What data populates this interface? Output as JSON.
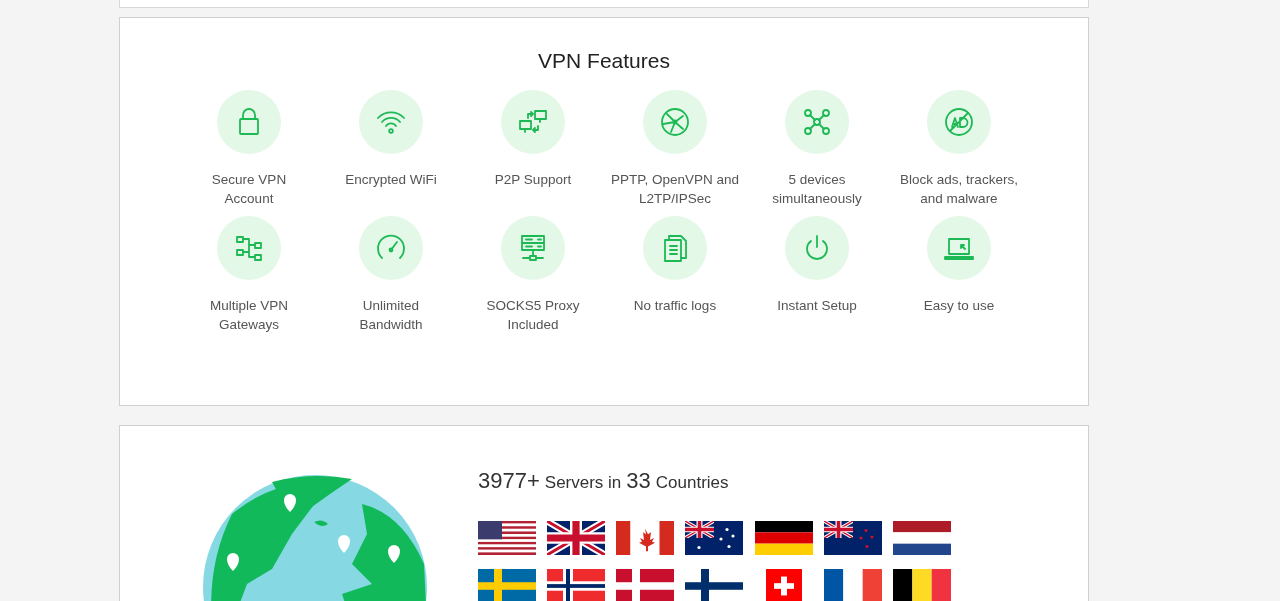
{
  "features": {
    "title": "VPN Features",
    "items": [
      {
        "kind": "lock",
        "label": "Secure VPN\nAccount"
      },
      {
        "kind": "wifi",
        "label": "Encrypted WiFi"
      },
      {
        "kind": "p2p",
        "label": "P2P Support"
      },
      {
        "kind": "protocol",
        "label": "PPTP, OpenVPN and\nL2TP/IPSec"
      },
      {
        "kind": "devices",
        "label": "5 devices\nsimultaneously"
      },
      {
        "kind": "noads",
        "label": "Block ads, trackers,\nand malware"
      },
      {
        "kind": "gateways",
        "label": "Multiple VPN\nGateways"
      },
      {
        "kind": "speed",
        "label": "Unlimited\nBandwidth"
      },
      {
        "kind": "server",
        "label": "SOCKS5 Proxy\nIncluded"
      },
      {
        "kind": "docs",
        "label": "No traffic logs"
      },
      {
        "kind": "power",
        "label": "Instant Setup"
      },
      {
        "kind": "laptop",
        "label": "Easy to use"
      }
    ]
  },
  "servers": {
    "server_count": "3977+",
    "servers_in": "Servers in",
    "country_count": "33",
    "countries": "Countries",
    "flags": [
      {
        "kind": "us"
      },
      {
        "kind": "uk"
      },
      {
        "kind": "ca"
      },
      {
        "kind": "au"
      },
      {
        "kind": "de"
      },
      {
        "kind": "nz"
      },
      {
        "kind": "nl"
      },
      {
        "kind": "se"
      },
      {
        "kind": "no"
      },
      {
        "kind": "dk"
      },
      {
        "kind": "fi"
      },
      {
        "kind": "ch"
      },
      {
        "kind": "fr"
      },
      {
        "kind": "be"
      }
    ]
  }
}
